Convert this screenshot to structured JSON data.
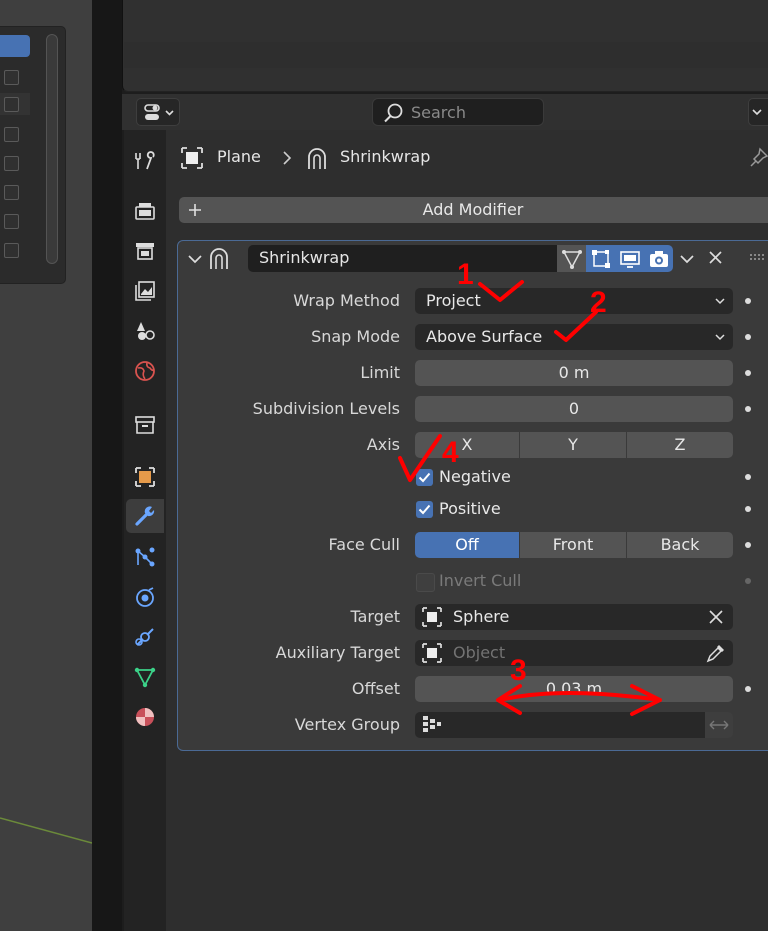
{
  "header": {
    "search_placeholder": "Search"
  },
  "breadcrumb": {
    "object": "Plane",
    "modifier": "Shrinkwrap"
  },
  "add_modifier_label": "Add Modifier",
  "modifier": {
    "name": "Shrinkwrap",
    "wrap_method": {
      "label": "Wrap Method",
      "value": "Project"
    },
    "snap_mode": {
      "label": "Snap Mode",
      "value": "Above Surface"
    },
    "limit": {
      "label": "Limit",
      "value": "0 m"
    },
    "subdivision_levels": {
      "label": "Subdivision Levels",
      "value": "0"
    },
    "axis": {
      "label": "Axis",
      "options": [
        "X",
        "Y",
        "Z"
      ]
    },
    "negative": {
      "label": "Negative",
      "checked": true
    },
    "positive": {
      "label": "Positive",
      "checked": true
    },
    "face_cull": {
      "label": "Face Cull",
      "options": [
        "Off",
        "Front",
        "Back"
      ],
      "selected": "Off"
    },
    "invert_cull": {
      "label": "Invert Cull",
      "checked": false
    },
    "target": {
      "label": "Target",
      "value": "Sphere"
    },
    "auxiliary_target": {
      "label": "Auxiliary Target",
      "placeholder": "Object"
    },
    "offset": {
      "label": "Offset",
      "value": "0.03 m"
    },
    "vertex_group": {
      "label": "Vertex Group",
      "value": ""
    }
  },
  "annotations": [
    "1",
    "2",
    "3",
    "4"
  ],
  "colors": {
    "accent_blue": "#4772b3",
    "annotation_red": "#ff0000",
    "panel_bg": "#3a3a3a",
    "field_bg": "#545454"
  }
}
